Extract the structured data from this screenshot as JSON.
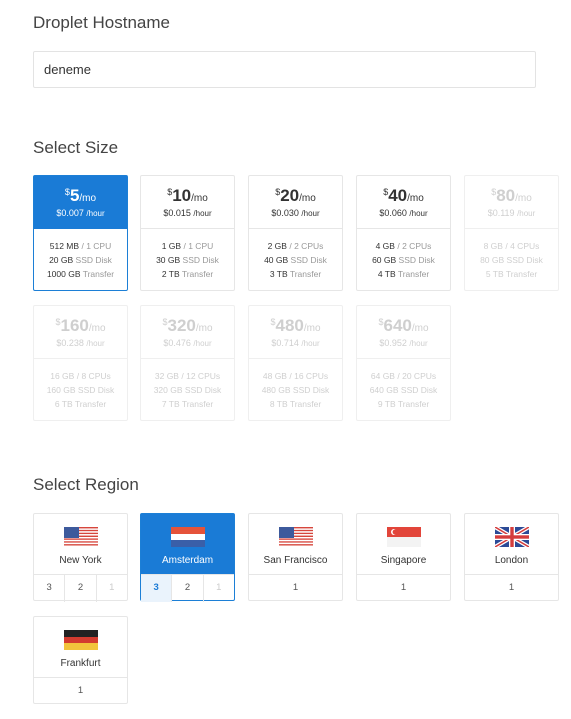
{
  "hostname": {
    "title": "Droplet Hostname",
    "value": "deneme"
  },
  "size": {
    "title": "Select Size",
    "plans": [
      {
        "currency": "$",
        "amount": "5",
        "per": "/mo",
        "hourly": "$0.007",
        "hour_unit": "/hour",
        "ram": "512 MB",
        "cpu": "1 CPU",
        "disk": "20 GB",
        "disk_label": "SSD Disk",
        "transfer": "1000 GB",
        "transfer_label": "Transfer",
        "state": "selected"
      },
      {
        "currency": "$",
        "amount": "10",
        "per": "/mo",
        "hourly": "$0.015",
        "hour_unit": "/hour",
        "ram": "1 GB",
        "cpu": "1 CPU",
        "disk": "30 GB",
        "disk_label": "SSD Disk",
        "transfer": "2 TB",
        "transfer_label": "Transfer",
        "state": "available"
      },
      {
        "currency": "$",
        "amount": "20",
        "per": "/mo",
        "hourly": "$0.030",
        "hour_unit": "/hour",
        "ram": "2 GB",
        "cpu": "2 CPUs",
        "disk": "40 GB",
        "disk_label": "SSD Disk",
        "transfer": "3 TB",
        "transfer_label": "Transfer",
        "state": "available"
      },
      {
        "currency": "$",
        "amount": "40",
        "per": "/mo",
        "hourly": "$0.060",
        "hour_unit": "/hour",
        "ram": "4 GB",
        "cpu": "2 CPUs",
        "disk": "60 GB",
        "disk_label": "SSD Disk",
        "transfer": "4 TB",
        "transfer_label": "Transfer",
        "state": "available"
      },
      {
        "currency": "$",
        "amount": "80",
        "per": "/mo",
        "hourly": "$0.119",
        "hour_unit": "/hour",
        "ram": "8 GB",
        "cpu": "4 CPUs",
        "disk": "80 GB",
        "disk_label": "SSD Disk",
        "transfer": "5 TB",
        "transfer_label": "Transfer",
        "state": "disabled"
      },
      {
        "currency": "$",
        "amount": "160",
        "per": "/mo",
        "hourly": "$0.238",
        "hour_unit": "/hour",
        "ram": "16 GB",
        "cpu": "8 CPUs",
        "disk": "160 GB",
        "disk_label": "SSD Disk",
        "transfer": "6 TB",
        "transfer_label": "Transfer",
        "state": "disabled"
      },
      {
        "currency": "$",
        "amount": "320",
        "per": "/mo",
        "hourly": "$0.476",
        "hour_unit": "/hour",
        "ram": "32 GB",
        "cpu": "12 CPUs",
        "disk": "320 GB",
        "disk_label": "SSD Disk",
        "transfer": "7 TB",
        "transfer_label": "Transfer",
        "state": "disabled"
      },
      {
        "currency": "$",
        "amount": "480",
        "per": "/mo",
        "hourly": "$0.714",
        "hour_unit": "/hour",
        "ram": "48 GB",
        "cpu": "16 CPUs",
        "disk": "480 GB",
        "disk_label": "SSD Disk",
        "transfer": "8 TB",
        "transfer_label": "Transfer",
        "state": "disabled"
      },
      {
        "currency": "$",
        "amount": "640",
        "per": "/mo",
        "hourly": "$0.952",
        "hour_unit": "/hour",
        "ram": "64 GB",
        "cpu": "20 CPUs",
        "disk": "640 GB",
        "disk_label": "SSD Disk",
        "transfer": "9 TB",
        "transfer_label": "Transfer",
        "state": "disabled"
      }
    ]
  },
  "region": {
    "title": "Select Region",
    "regions": [
      {
        "name": "New York",
        "flag": "us-flag-icon",
        "datacenters": [
          "3",
          "2",
          "1"
        ],
        "unavailable": [
          2
        ],
        "state": "available"
      },
      {
        "name": "Amsterdam",
        "flag": "nl-flag-icon",
        "datacenters": [
          "3",
          "2",
          "1"
        ],
        "unavailable": [
          2
        ],
        "active": 0,
        "state": "selected"
      },
      {
        "name": "San Francisco",
        "flag": "us-flag-icon",
        "datacenters": [
          "1"
        ],
        "unavailable": [],
        "state": "available"
      },
      {
        "name": "Singapore",
        "flag": "sg-flag-icon",
        "datacenters": [
          "1"
        ],
        "unavailable": [],
        "state": "available"
      },
      {
        "name": "London",
        "flag": "uk-flag-icon",
        "datacenters": [
          "1"
        ],
        "unavailable": [],
        "state": "available"
      },
      {
        "name": "Frankfurt",
        "flag": "de-flag-icon",
        "datacenters": [
          "1"
        ],
        "unavailable": [],
        "state": "available"
      }
    ]
  },
  "colors": {
    "accent": "#1a7bd6",
    "border": "#e6e6e6",
    "muted": "#999999",
    "disabled": "#cfcfcf"
  }
}
